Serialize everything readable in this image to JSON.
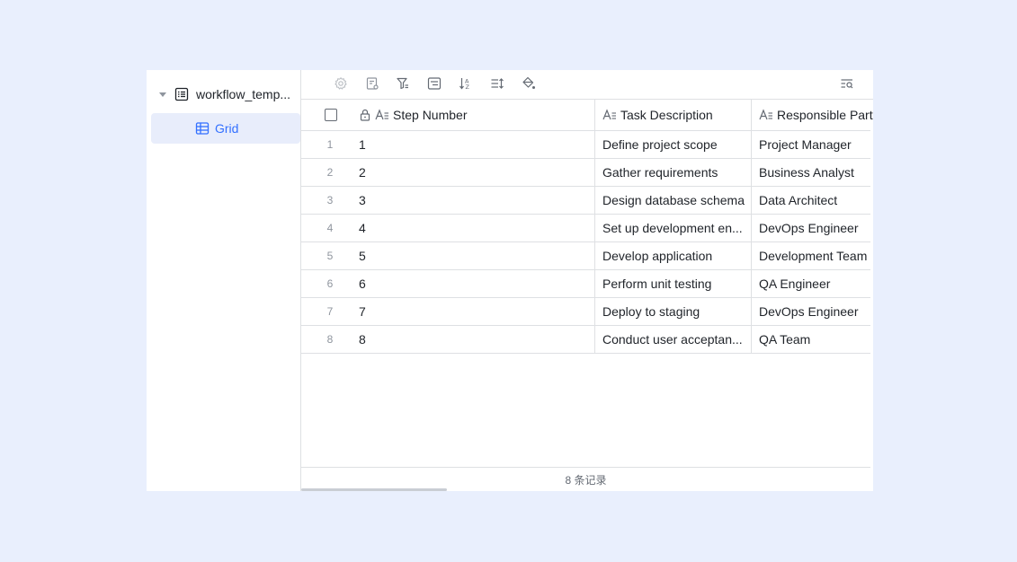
{
  "sidebar": {
    "table_name": "workflow_temp...",
    "view_name": "Grid"
  },
  "toolbar": {
    "icons": [
      "settings-icon",
      "field-settings-icon",
      "filter-icon",
      "group-icon",
      "sort-icon",
      "row-height-icon",
      "color-fill-icon",
      "search-icon"
    ]
  },
  "grid": {
    "columns": [
      {
        "label": "Step Number"
      },
      {
        "label": "Task Description"
      },
      {
        "label": "Responsible Party"
      }
    ],
    "rows": [
      {
        "index": "1",
        "step": "1",
        "task": "Define project scope",
        "party": "Project Manager"
      },
      {
        "index": "2",
        "step": "2",
        "task": "Gather requirements",
        "party": "Business Analyst"
      },
      {
        "index": "3",
        "step": "3",
        "task": "Design database schema",
        "party": "Data Architect"
      },
      {
        "index": "4",
        "step": "4",
        "task": "Set up development en...",
        "party": "DevOps Engineer"
      },
      {
        "index": "5",
        "step": "5",
        "task": "Develop application",
        "party": "Development Team"
      },
      {
        "index": "6",
        "step": "6",
        "task": "Perform unit testing",
        "party": "QA Engineer"
      },
      {
        "index": "7",
        "step": "7",
        "task": "Deploy to staging",
        "party": "DevOps Engineer"
      },
      {
        "index": "8",
        "step": "8",
        "task": "Conduct user acceptan...",
        "party": "QA Team"
      }
    ]
  },
  "footer": {
    "record_count": "8 条记录"
  },
  "colors": {
    "accent": "#3370ff",
    "background": "#e9effd",
    "selected_bg": "#e8edfb",
    "border": "#dee0e3"
  }
}
